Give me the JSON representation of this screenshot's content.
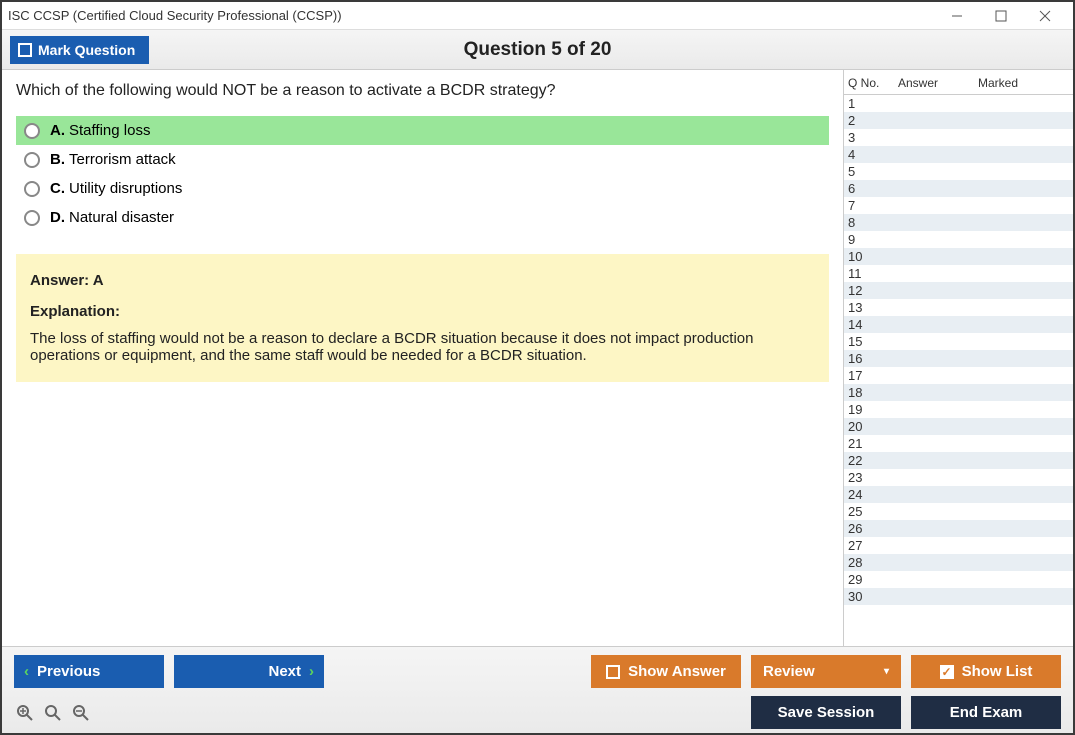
{
  "window": {
    "title": "ISC CCSP (Certified Cloud Security Professional (CCSP))"
  },
  "header": {
    "mark_label": "Mark Question",
    "question_counter": "Question 5 of 20"
  },
  "question": {
    "text": "Which of the following would NOT be a reason to activate a BCDR strategy?",
    "options": [
      {
        "letter": "A.",
        "text": "Staffing loss",
        "highlight": true
      },
      {
        "letter": "B.",
        "text": "Terrorism attack",
        "highlight": false
      },
      {
        "letter": "C.",
        "text": "Utility disruptions",
        "highlight": false
      },
      {
        "letter": "D.",
        "text": "Natural disaster",
        "highlight": false
      }
    ],
    "answer_label": "Answer: A",
    "explanation_label": "Explanation:",
    "explanation_text": "The loss of staffing would not be a reason to declare a BCDR situation because it does not impact production operations or equipment, and the same staff would be needed for a BCDR situation."
  },
  "sidebar": {
    "headers": {
      "qno": "Q No.",
      "answer": "Answer",
      "marked": "Marked"
    },
    "rows": [
      1,
      2,
      3,
      4,
      5,
      6,
      7,
      8,
      9,
      10,
      11,
      12,
      13,
      14,
      15,
      16,
      17,
      18,
      19,
      20,
      21,
      22,
      23,
      24,
      25,
      26,
      27,
      28,
      29,
      30
    ]
  },
  "footer": {
    "previous": "Previous",
    "next": "Next",
    "show_answer": "Show Answer",
    "review": "Review",
    "show_list": "Show List",
    "save_session": "Save Session",
    "end_exam": "End Exam"
  }
}
